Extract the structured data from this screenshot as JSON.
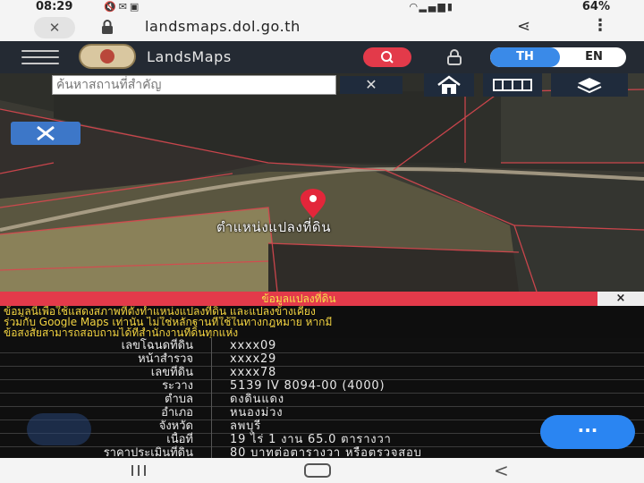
{
  "statusbar": {
    "time": "08:29",
    "battery": "64%",
    "icons_left": [
      "silent-icon",
      "mail-icon",
      "gallery-icon"
    ],
    "icons_right": [
      "wifi-icon",
      "signal-icon",
      "battery-icon"
    ]
  },
  "browser": {
    "close": "✕",
    "url": "landsmaps.dol.go.th",
    "menu": "⋮"
  },
  "app": {
    "brand": "LandsMaps",
    "lang_th": "TH",
    "lang_en": "EN",
    "active_lang": "TH"
  },
  "map": {
    "search_placeholder": "ค้นหาสถานที่สำคัญ",
    "clear": "✕",
    "marker_label": "ตำแหน่งแปลงที่ดิน"
  },
  "panel": {
    "title": "ข้อมูลแปลงที่ดิน",
    "close": "×",
    "disclaimer": [
      "ข้อมูลนี้เพื่อใช้แสดงสภาพที่ตั้งทำแหน่งแปลงที่ดิน และแปลงข้างเคียง",
      "ร่วมกับ Google Maps เท่านั้น ไม่ใช่หลักฐานที่ใช้ในทางกฎหมาย หากมี",
      "ข้อสงสัยสามารถสอบถามได้ที่สำนักงานที่ดินทุกแห่ง"
    ],
    "rows": [
      {
        "label": "เลขโฉนดที่ดิน",
        "value": "xxxx09"
      },
      {
        "label": "หน้าสำรวจ",
        "value": "xxxx29"
      },
      {
        "label": "เลขที่ดิน",
        "value": "xxxx78"
      },
      {
        "label": "ระวาง",
        "value": "5139 IV 8094-00 (4000)"
      },
      {
        "label": "ตำบล",
        "value": "ดงดินแดง"
      },
      {
        "label": "อำเภอ",
        "value": "หนองม่วง"
      },
      {
        "label": "จังหวัด",
        "value": "ลพบุรี"
      },
      {
        "label": "เนื้อที่",
        "value": "19 ไร่ 1 งาน 65.0 ตารางวา"
      },
      {
        "label": "ราคาประเมินที่ดิน",
        "value": "80 บาทต่อตารางวา หรือตรวจสอบ"
      }
    ]
  },
  "fab": "···",
  "colors": {
    "accent_red": "#e33a4a",
    "accent_blue": "#3a8ae8",
    "header": "#242a33",
    "disclaimer_text": "#f2d341"
  }
}
